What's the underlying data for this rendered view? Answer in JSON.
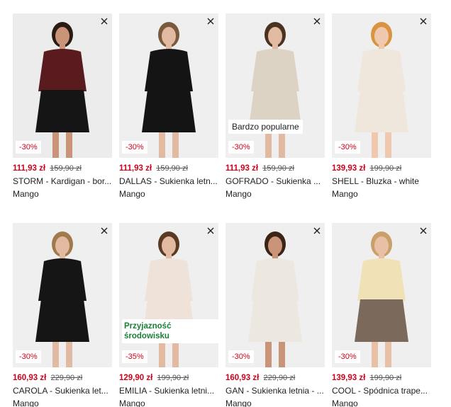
{
  "products": [
    {
      "id": "p1",
      "discount": "-30%",
      "price_now": "111,93 zł",
      "price_old": "159,90 zł",
      "name": "STORM - Kardigan - bor...",
      "brand": "Mango",
      "flag": "",
      "colors": {
        "bg": "#ececec",
        "top": "#5a1b1f",
        "bottom": "#151515",
        "skin": "#c99478",
        "hair": "#2a1b14"
      }
    },
    {
      "id": "p2",
      "discount": "-30%",
      "price_now": "111,93 zł",
      "price_old": "159,90 zł",
      "name": "DALLAS - Sukienka letn...",
      "brand": "Mango",
      "flag": "",
      "colors": {
        "bg": "#efefef",
        "top": "#141414",
        "bottom": "#141414",
        "skin": "#e2b9a1",
        "hair": "#7a5a3c"
      }
    },
    {
      "id": "p3",
      "discount": "-30%",
      "price_now": "111,93 zł",
      "price_old": "159,90 zł",
      "name": "GOFRADO - Sukienka ...",
      "brand": "Mango",
      "flag": "Bardzo popularne",
      "colors": {
        "bg": "#efefef",
        "top": "#ddd3c4",
        "bottom": "#ddd3c4",
        "skin": "#e2b9a1",
        "hair": "#4a3220"
      }
    },
    {
      "id": "p4",
      "discount": "-30%",
      "price_now": "139,93 zł",
      "price_old": "199,90 zł",
      "name": "SHELL - Bluzka - white",
      "brand": "Mango",
      "flag": "",
      "colors": {
        "bg": "#efefef",
        "top": "#efe7dc",
        "bottom": "#efe7dc",
        "skin": "#f0c8ae",
        "hair": "#d9943f"
      }
    },
    {
      "id": "p5",
      "discount": "-30%",
      "price_now": "160,93 zł",
      "price_old": "229,90 zł",
      "name": "CAROLA - Sukienka let...",
      "brand": "Mango",
      "flag": "",
      "colors": {
        "bg": "#efefef",
        "top": "#151515",
        "bottom": "#151515",
        "skin": "#e2b9a1",
        "hair": "#a07a4c"
      }
    },
    {
      "id": "p6",
      "discount": "-35%",
      "price_now": "129,90 zł",
      "price_old": "199,90 zł",
      "name": "EMILIA - Sukienka letni...",
      "brand": "Mango",
      "flag": "Przyjazność środowisku",
      "colors": {
        "bg": "#efefef",
        "top": "#efe2d8",
        "bottom": "#efe2d8",
        "skin": "#e2b9a1",
        "hair": "#5a3a22"
      }
    },
    {
      "id": "p7",
      "discount": "-30%",
      "price_now": "160,93 zł",
      "price_old": "229,90 zł",
      "name": "GAN - Sukienka letnia - ...",
      "brand": "Mango",
      "flag": "",
      "colors": {
        "bg": "#efefef",
        "top": "#ece8e0",
        "bottom": "#ece8e0",
        "skin": "#c99478",
        "hair": "#3a2416"
      }
    },
    {
      "id": "p8",
      "discount": "-30%",
      "price_now": "139,93 zł",
      "price_old": "199,90 zł",
      "name": "COOL - Spódnica trape...",
      "brand": "Mango",
      "flag": "",
      "colors": {
        "bg": "#efefef",
        "top": "#f0e2b6",
        "bottom": "#7b6a5c",
        "skin": "#e8c0a6",
        "hair": "#c9a06a"
      }
    }
  ]
}
